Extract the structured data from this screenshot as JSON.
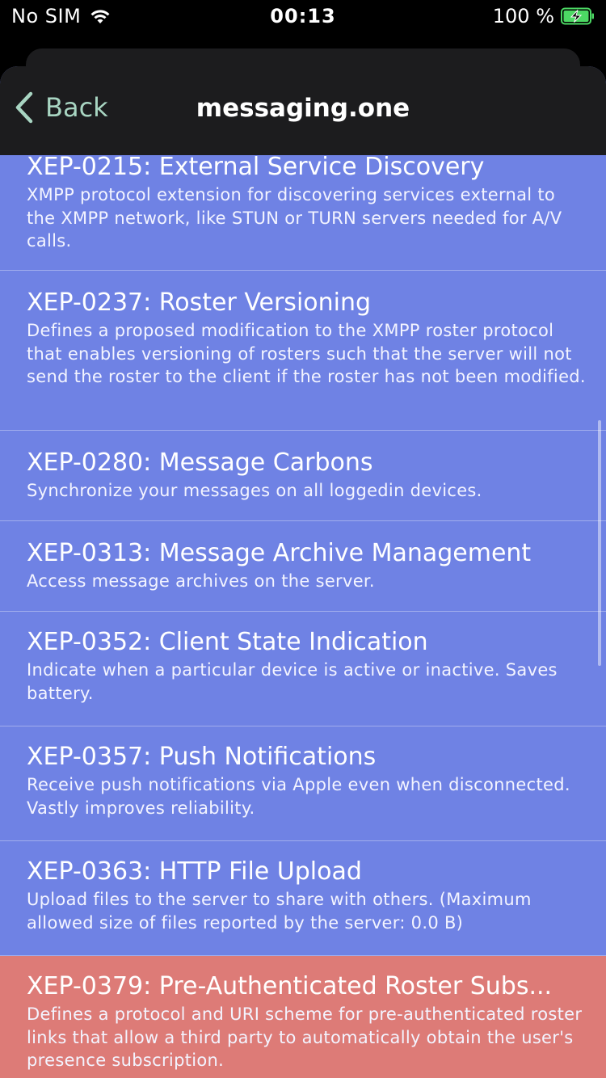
{
  "status_bar": {
    "carrier": "No SIM",
    "time": "00:13",
    "battery": "100 %"
  },
  "nav": {
    "back_label": "Back",
    "title": "messaging.one"
  },
  "colors": {
    "list_background": "#6f82e4",
    "highlight_row": "#dd7b77",
    "back_tint": "#a8d5c2",
    "navbar": "#1c1c1e"
  },
  "items": [
    {
      "title": "XEP-0215: External Service Discovery",
      "description": "XMPP protocol extension for discovering services external to the XMPP network, like STUN or TURN servers needed for A/V calls."
    },
    {
      "title": "XEP-0237: Roster Versioning",
      "description": "Defines a proposed modification to the XMPP roster protocol that enables versioning of rosters such that the server will not send the roster to the client if the roster has not been modified."
    },
    {
      "title": "XEP-0280: Message Carbons",
      "description": "Synchronize your messages on all loggedin devices."
    },
    {
      "title": "XEP-0313: Message Archive Management",
      "description": "Access message archives on the server."
    },
    {
      "title": "XEP-0352: Client State Indication",
      "description": "Indicate when a particular device is active or inactive. Saves battery."
    },
    {
      "title": "XEP-0357: Push Notifications",
      "description": "Receive push notifications via Apple even when disconnected. Vastly improves reliability."
    },
    {
      "title": "XEP-0363: HTTP File Upload",
      "description": "Upload files to the server to share with others. (Maximum allowed size of files reported by the server: 0.0 B)"
    },
    {
      "title": "XEP-0379: Pre-Authenticated Roster Subs...",
      "description": "Defines a protocol and URI scheme for pre-authenticated roster links that allow a third party to automatically obtain the user's presence subscription."
    }
  ]
}
